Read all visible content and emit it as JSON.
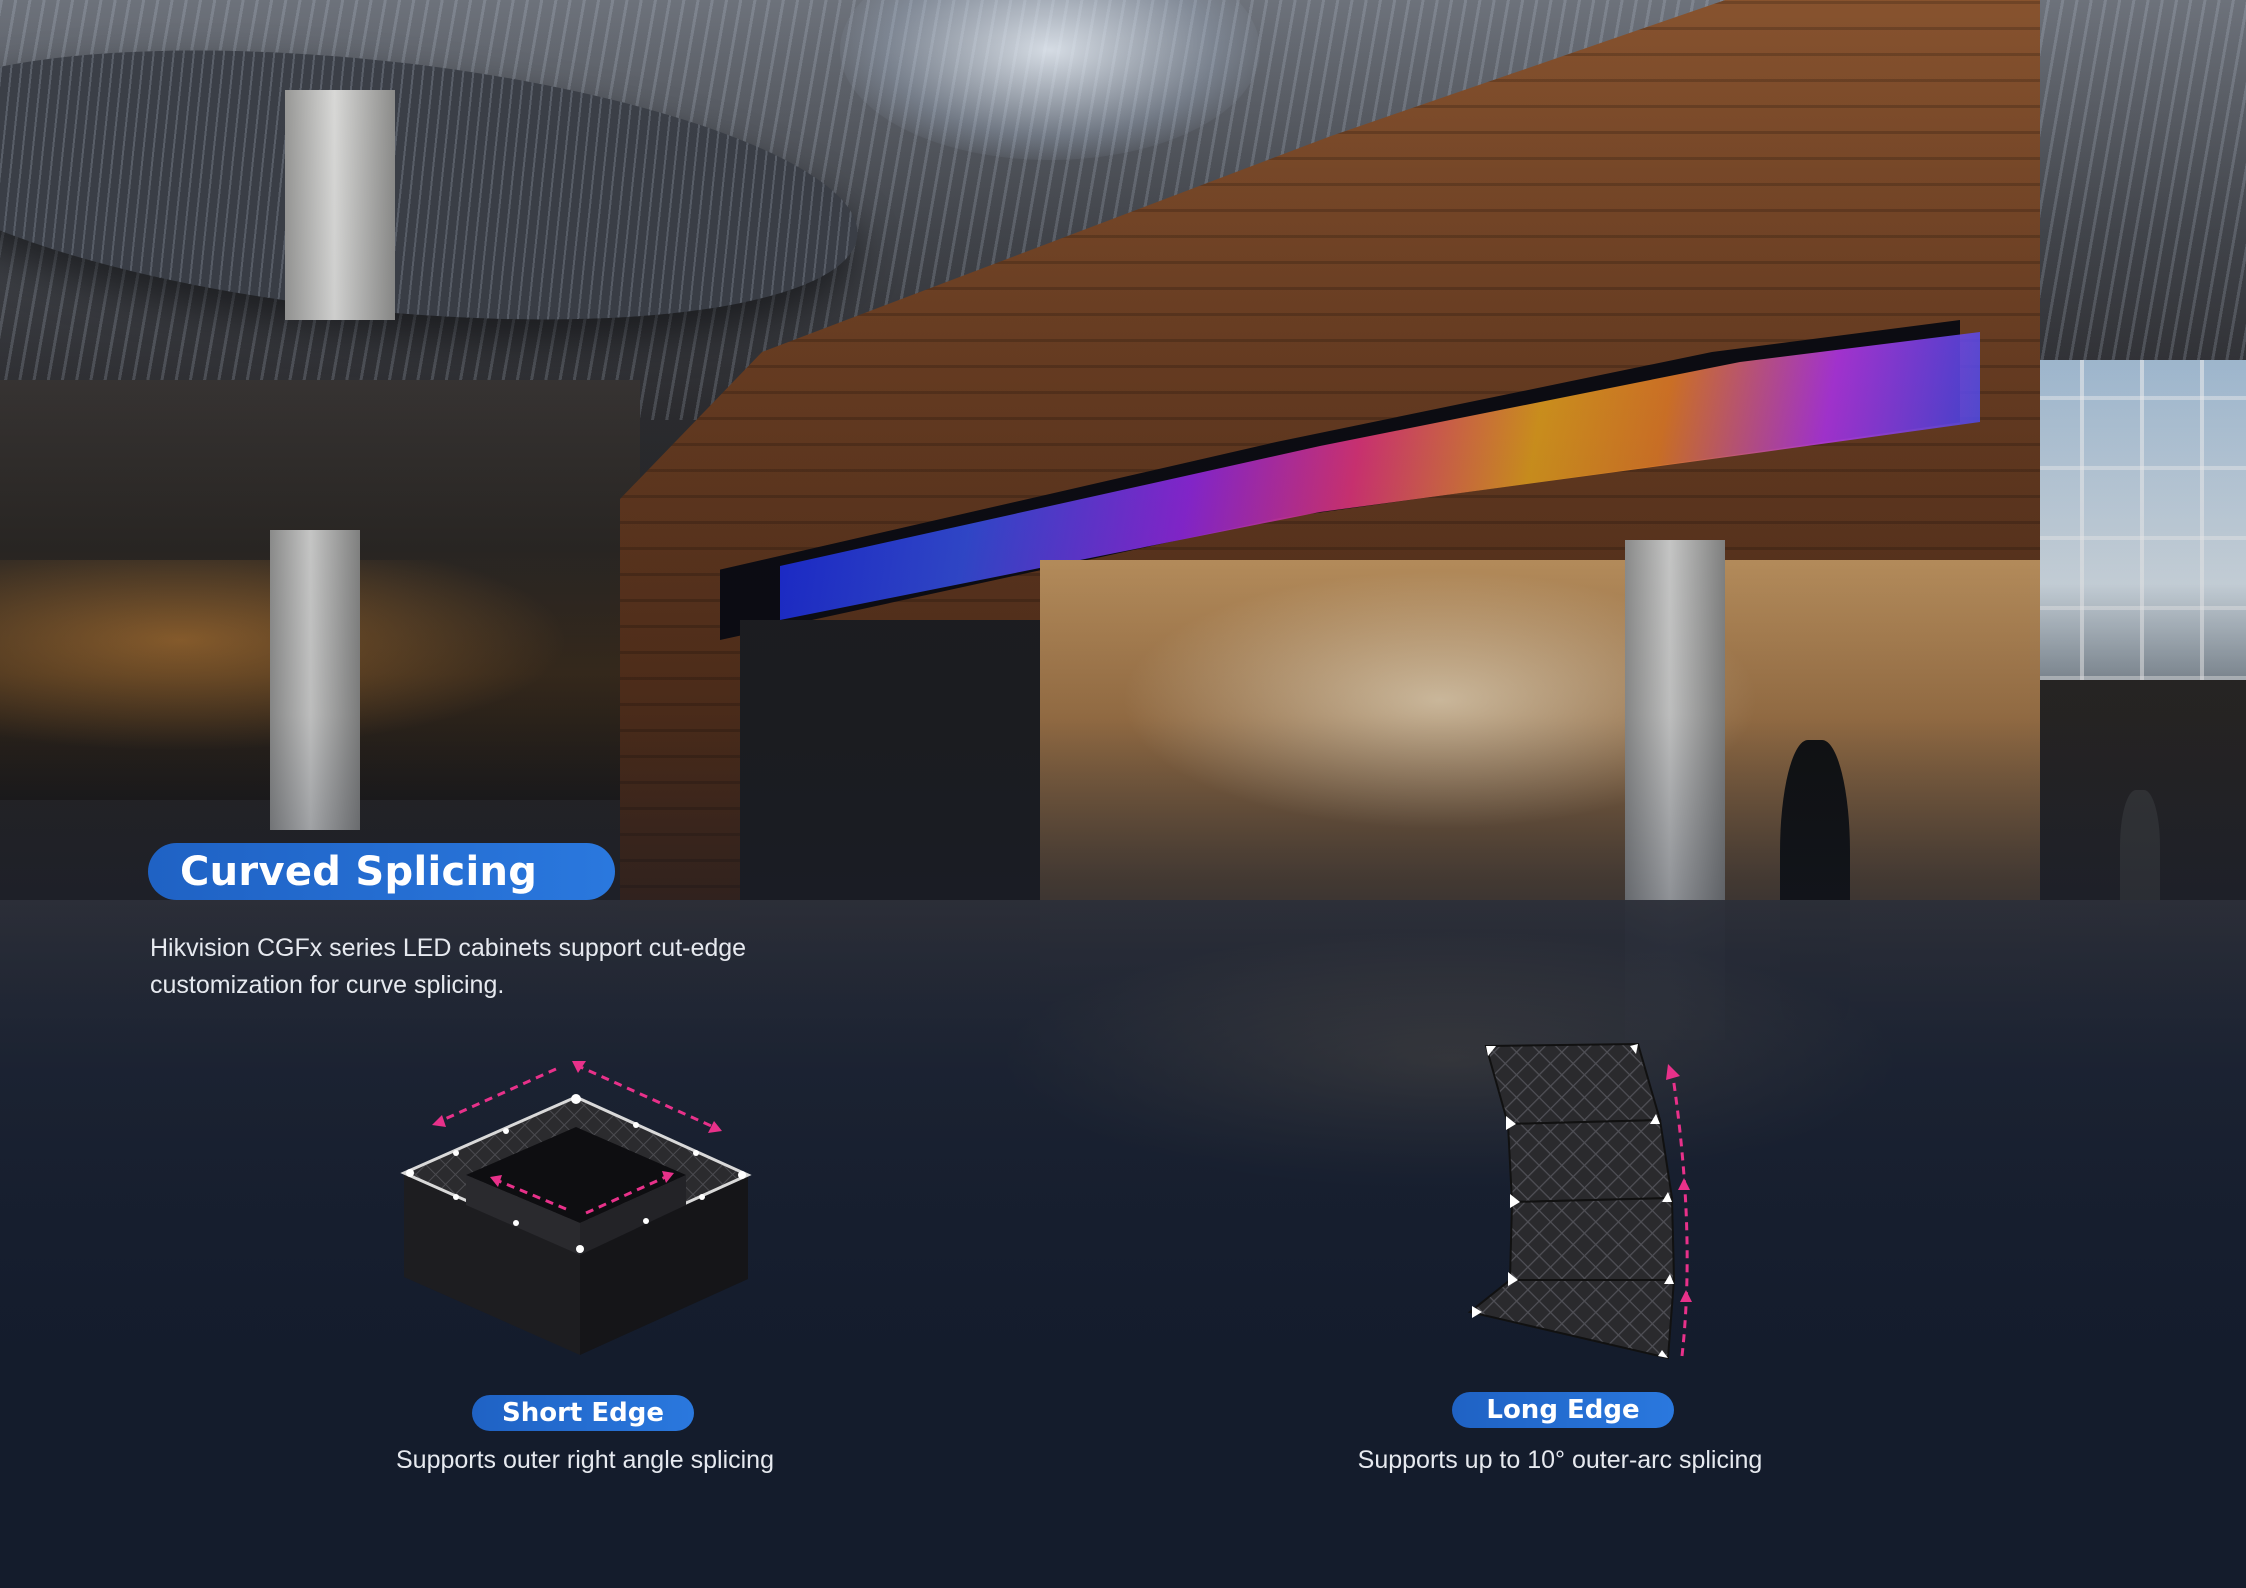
{
  "heading": {
    "title": "Curved Splicing",
    "description": "Hikvision CGFx series LED cabinets support cut-edge customization for curve splicing."
  },
  "short_edge": {
    "label": "Short Edge",
    "caption": "Supports outer right angle splicing",
    "illustration": "square-cabinet-ring-icon"
  },
  "long_edge": {
    "label": "Long Edge",
    "caption": "Supports up to 10° outer-arc splicing",
    "illustration": "curved-cabinet-stack-icon"
  },
  "colors": {
    "accent_blue": "#2a6fd6",
    "arrow_pink": "#e8318a",
    "background_navy": "#141c2c",
    "text_light": "#e6e9ef"
  }
}
